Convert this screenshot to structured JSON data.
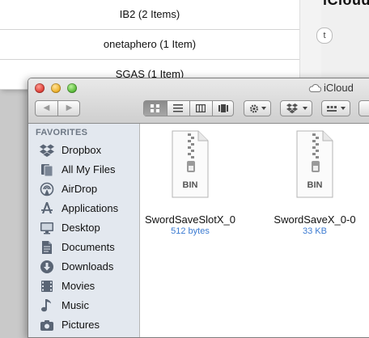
{
  "background_window": {
    "rows": [
      {
        "label": "IB2 (2 Items)"
      },
      {
        "label": "onetaphero (1 Item)"
      },
      {
        "label": "SGAS (1 Item)"
      }
    ],
    "right_title_fragment": "iCloud",
    "right_pill": "t"
  },
  "finder": {
    "title": "iCloud",
    "sidebar": {
      "heading": "FAVORITES",
      "items": [
        {
          "label": "Dropbox",
          "icon": "dropbox-icon"
        },
        {
          "label": "All My Files",
          "icon": "all-files-icon"
        },
        {
          "label": "AirDrop",
          "icon": "airdrop-icon"
        },
        {
          "label": "Applications",
          "icon": "applications-icon"
        },
        {
          "label": "Desktop",
          "icon": "desktop-icon"
        },
        {
          "label": "Documents",
          "icon": "documents-icon"
        },
        {
          "label": "Downloads",
          "icon": "downloads-icon"
        },
        {
          "label": "Movies",
          "icon": "movies-icon"
        },
        {
          "label": "Music",
          "icon": "music-icon"
        },
        {
          "label": "Pictures",
          "icon": "pictures-icon"
        }
      ]
    },
    "files": [
      {
        "name": "SwordSaveSlotX_0",
        "size": "512 bytes",
        "badge": "BIN"
      },
      {
        "name": "SwordSaveX_0-0",
        "size": "33 KB",
        "badge": "BIN"
      }
    ]
  }
}
